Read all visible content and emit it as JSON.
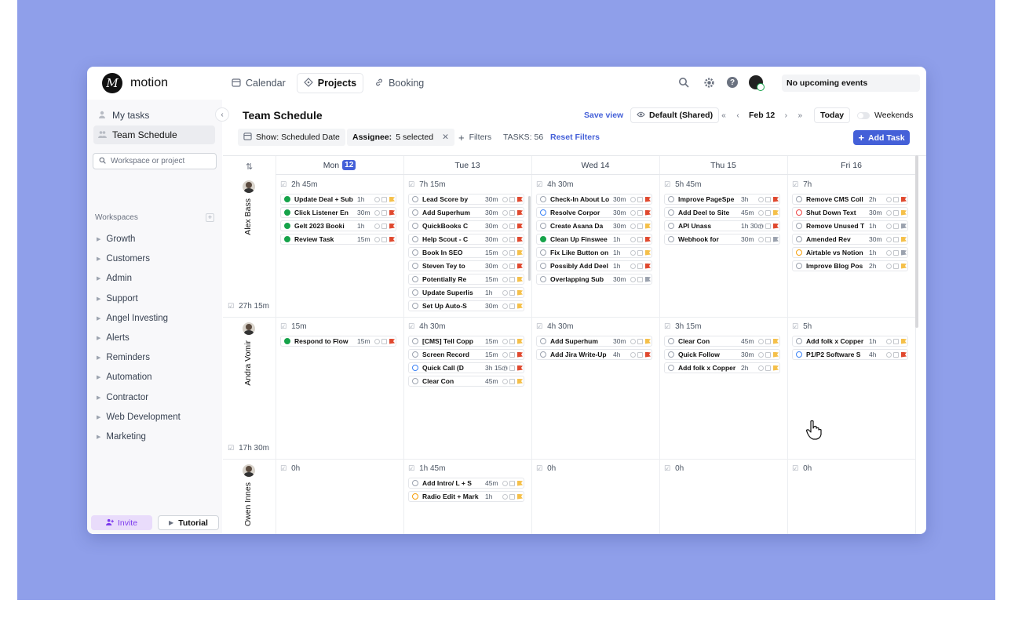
{
  "app": {
    "name": "motion",
    "logo_letter": "M"
  },
  "nav": [
    {
      "label": "Calendar",
      "icon": "calendar-icon",
      "active": false
    },
    {
      "label": "Projects",
      "icon": "projects-icon",
      "active": true
    },
    {
      "label": "Booking",
      "icon": "link-icon",
      "active": false
    }
  ],
  "topbar": {
    "events": "No upcoming events"
  },
  "sidebar": {
    "my_tasks": "My tasks",
    "team_schedule": "Team Schedule",
    "search_placeholder": "Workspace or project",
    "workspaces_label": "Workspaces",
    "workspaces": [
      "Growth",
      "Customers",
      "Admin",
      "Support",
      "Angel Investing",
      "Alerts",
      "Reminders",
      "Automation",
      "Contractor",
      "Web Development",
      "Marketing"
    ],
    "invite": "Invite",
    "tutorial": "Tutorial"
  },
  "header": {
    "title": "Team Schedule",
    "save_view": "Save view",
    "view": "Default (Shared)",
    "date": "Feb 12",
    "today": "Today",
    "weekends": "Weekends"
  },
  "filters": {
    "show": "Show: Scheduled Date",
    "assignee_label": "Assignee:",
    "assignee_value": "5 selected",
    "filters": "Filters",
    "tasks_count": "TASKS: 56",
    "reset": "Reset Filters",
    "add_task": "Add Task"
  },
  "days": [
    {
      "name": "Mon",
      "num": "12",
      "today": true
    },
    {
      "name": "Tue 13",
      "num": "",
      "today": false
    },
    {
      "name": "Wed 14",
      "num": "",
      "today": false
    },
    {
      "name": "Thu 15",
      "num": "",
      "today": false
    },
    {
      "name": "Fri 16",
      "num": "",
      "today": false
    }
  ],
  "people": [
    {
      "name": "Alex Bass",
      "total": "27h 15m",
      "day_totals": [
        "2h 45m",
        "7h 15m",
        "4h 30m",
        "5h 45m",
        "7h"
      ],
      "tasks": [
        [
          {
            "name": "Update Deal + Sub",
            "dur": "1h",
            "status": "done",
            "flag": "#f5c04a"
          },
          {
            "name": "Click Listener En",
            "dur": "30m",
            "status": "done",
            "flag": "#e0492f"
          },
          {
            "name": "Gelt 2023 Booki",
            "dur": "1h",
            "status": "done",
            "flag": "#e0492f"
          },
          {
            "name": "Review Task",
            "dur": "15m",
            "status": "done",
            "flag": "#e0492f"
          }
        ],
        [
          {
            "name": "Lead Score by",
            "dur": "30m",
            "status": "open",
            "flag": "#e0492f"
          },
          {
            "name": "Add Superhum",
            "dur": "30m",
            "status": "open",
            "flag": "#e0492f"
          },
          {
            "name": "QuickBooks C",
            "dur": "30m",
            "status": "open",
            "flag": "#e0492f"
          },
          {
            "name": "Help Scout - C",
            "dur": "30m",
            "status": "open",
            "flag": "#e0492f"
          },
          {
            "name": "Book In SEO",
            "dur": "15m",
            "status": "open",
            "flag": "#f5c04a"
          },
          {
            "name": "Steven Tey to",
            "dur": "30m",
            "status": "open",
            "flag": "#e0492f"
          },
          {
            "name": "Potentially Re",
            "dur": "15m",
            "status": "open",
            "flag": "#f5c04a"
          },
          {
            "name": "Update Superlis",
            "dur": "1h",
            "status": "open",
            "flag": "#f5c04a"
          },
          {
            "name": "Set Up Auto-S",
            "dur": "30m",
            "status": "open",
            "flag": "#f5c04a"
          }
        ],
        [
          {
            "name": "Check-In About Lo",
            "dur": "30m",
            "status": "open",
            "flag": "#e0492f"
          },
          {
            "name": "Resolve Corpor",
            "dur": "30m",
            "status": "blue",
            "flag": "#e0492f"
          },
          {
            "name": "Create Asana Da",
            "dur": "30m",
            "status": "open",
            "flag": "#f5c04a"
          },
          {
            "name": "Clean Up Finswee",
            "dur": "1h",
            "status": "done",
            "flag": "#e0492f"
          },
          {
            "name": "Fix Like Button on",
            "dur": "1h",
            "status": "open",
            "flag": "#f5c04a"
          },
          {
            "name": "Possibly Add Deel",
            "dur": "1h",
            "status": "open",
            "flag": "#e0492f"
          },
          {
            "name": "Overlapping Sub",
            "dur": "30m",
            "status": "open",
            "flag": "#9ca3af"
          }
        ],
        [
          {
            "name": "Improve PageSpe",
            "dur": "3h",
            "status": "open",
            "flag": "#e0492f"
          },
          {
            "name": "Add Deel to Site",
            "dur": "45m",
            "status": "open",
            "flag": "#f5c04a"
          },
          {
            "name": "API Unass",
            "dur": "1h 30m",
            "status": "open",
            "flag": "#e0492f"
          },
          {
            "name": "Webhook for",
            "dur": "30m",
            "status": "open",
            "flag": "#9ca3af"
          }
        ],
        [
          {
            "name": "Remove CMS Coll",
            "dur": "2h",
            "status": "open",
            "flag": "#e0492f"
          },
          {
            "name": "Shut Down Text",
            "dur": "30m",
            "status": "red",
            "flag": "#f5c04a"
          },
          {
            "name": "Remove Unused T",
            "dur": "1h",
            "status": "open",
            "flag": "#9ca3af"
          },
          {
            "name": "Amended Rev",
            "dur": "30m",
            "status": "open",
            "flag": "#f5c04a"
          },
          {
            "name": "Airtable vs Notion",
            "dur": "1h",
            "status": "amber",
            "flag": "#9ca3af"
          },
          {
            "name": "Improve Blog Pos",
            "dur": "2h",
            "status": "open",
            "flag": "#f5c04a"
          }
        ]
      ]
    },
    {
      "name": "Andra Vomir",
      "total": "17h 30m",
      "day_totals": [
        "15m",
        "4h 30m",
        "4h 30m",
        "3h 15m",
        "5h"
      ],
      "tasks": [
        [
          {
            "name": "Respond to Flow",
            "dur": "15m",
            "status": "done",
            "flag": "#e0492f"
          }
        ],
        [
          {
            "name": "[CMS] Tell Copp",
            "dur": "15m",
            "status": "open",
            "flag": "#f5c04a"
          },
          {
            "name": "Screen Record",
            "dur": "15m",
            "status": "open",
            "flag": "#e0492f"
          },
          {
            "name": "Quick Call (D",
            "dur": "3h 15m",
            "status": "blue",
            "flag": "#e0492f"
          },
          {
            "name": "Clear Con",
            "dur": "45m",
            "status": "open",
            "flag": "#f5c04a"
          }
        ],
        [
          {
            "name": "Add Superhum",
            "dur": "30m",
            "status": "open",
            "flag": "#f5c04a"
          },
          {
            "name": "Add Jira Write-Up",
            "dur": "4h",
            "status": "open",
            "flag": "#e0492f"
          }
        ],
        [
          {
            "name": "Clear Con",
            "dur": "45m",
            "status": "open",
            "flag": "#f5c04a"
          },
          {
            "name": "Quick Follow",
            "dur": "30m",
            "status": "open",
            "flag": "#f5c04a"
          },
          {
            "name": "Add folk x Copper",
            "dur": "2h",
            "status": "open",
            "flag": "#f5c04a"
          }
        ],
        [
          {
            "name": "Add folk x Copper",
            "dur": "1h",
            "status": "open",
            "flag": "#f5c04a"
          },
          {
            "name": "P1/P2 Software S",
            "dur": "4h",
            "status": "blue",
            "flag": "#e0492f"
          }
        ]
      ]
    },
    {
      "name": "Owen Innes",
      "total": "",
      "day_totals": [
        "0h",
        "1h 45m",
        "0h",
        "0h",
        "0h"
      ],
      "tasks": [
        [],
        [
          {
            "name": "Add Intro/ L + S",
            "dur": "45m",
            "status": "open",
            "flag": "#f5c04a"
          },
          {
            "name": "Radio Edit + Mark",
            "dur": "1h",
            "status": "amber",
            "flag": "#f5c04a"
          }
        ],
        [],
        [],
        []
      ]
    }
  ]
}
